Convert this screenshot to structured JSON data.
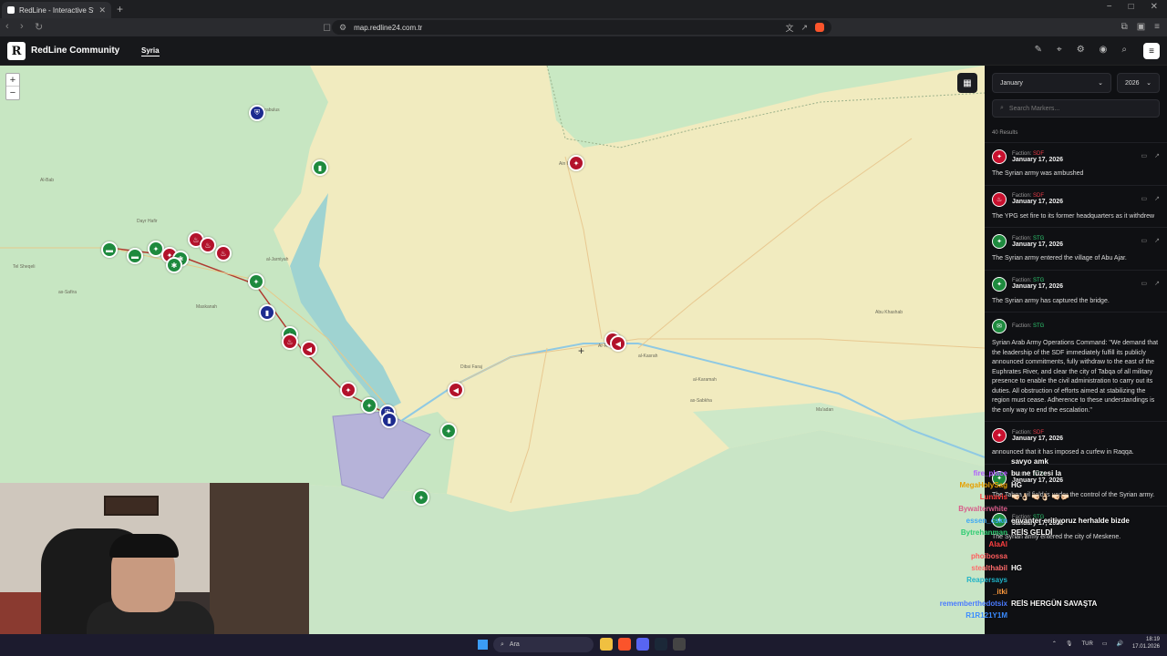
{
  "browser": {
    "tab_title": "RedLine - Interactive Strategic Map",
    "tab_close": "✕",
    "new_tab": "+",
    "url": "map.redline24.com.tr"
  },
  "header": {
    "logo_letter": "R",
    "brand": "RedLine Community",
    "nav_tab": "Syria"
  },
  "map": {
    "zoom_in": "+",
    "zoom_out": "−",
    "labels": [
      {
        "text": "Jarabulus"
      },
      {
        "text": "Al-Bab"
      },
      {
        "text": "Tel Sheqeli"
      },
      {
        "text": "as-Safira"
      },
      {
        "text": "al-Jarniyah"
      },
      {
        "text": "Ar-Raqqah"
      },
      {
        "text": "as-Sabkha"
      },
      {
        "text": "Dibsi Faraj"
      },
      {
        "text": "Maskanah"
      },
      {
        "text": "Ma'adan"
      },
      {
        "text": "Ain Issa"
      },
      {
        "text": "al-Karamah"
      },
      {
        "text": "Abu Khashab"
      },
      {
        "text": "al-Kasrah"
      },
      {
        "text": "Dayr Hafir"
      }
    ]
  },
  "sidebar": {
    "month": "January",
    "year": "2026",
    "search_placeholder": "Search Markers...",
    "results": "40 Results",
    "faction_label": "Faction:",
    "events": [
      {
        "faction": "SDF",
        "date": "January 17, 2026",
        "text": "The Syrian army was ambushed",
        "color": "#c8102e",
        "icon": "✦"
      },
      {
        "faction": "SDF",
        "date": "January 17, 2026",
        "text": "The YPG set fire to its former headquarters as it withdrew",
        "color": "#c8102e",
        "icon": "♨"
      },
      {
        "faction": "STG",
        "date": "January 17, 2026",
        "text": "The Syrian army entered the village of Abu Ajar.",
        "color": "#1e8a3e",
        "icon": "✦"
      },
      {
        "faction": "STG",
        "date": "January 17, 2026",
        "text": "The Syrian army has captured the bridge.",
        "color": "#1e8a3e",
        "icon": "✦"
      },
      {
        "faction": "STG",
        "date": "",
        "text": "Syrian Arab Army Operations Command: \"We demand that the leadership of the SDF immediately fulfill its publicly announced commitments, fully withdraw to the east of the Euphrates River, and clear the city of Tabqa of all military presence to enable the civil administration to carry out its duties. All obstruction of efforts aimed at stabilizing the region must cease. Adherence to these understandings is the only way to end the escalation.\"",
        "color": "#1e8a3e",
        "icon": "✉"
      },
      {
        "faction": "SDF",
        "date": "January 17, 2026",
        "text": "announced that it has imposed a curfew in Raqqa.",
        "color": "#c8102e",
        "icon": "✦"
      },
      {
        "faction": "STG",
        "date": "January 17, 2026",
        "text": "The Tabqa oil field is under the control of the Syrian army.",
        "color": "#1e8a3e",
        "icon": "✦"
      },
      {
        "faction": "STG",
        "date": "January 17, 2026",
        "text": "The Syrian army entered the city of Meskene.",
        "color": "#1e8a3e",
        "icon": "✦"
      }
    ]
  },
  "chat": [
    {
      "user": "",
      "msg": "savyo amk",
      "color": "#ff8c00"
    },
    {
      "user": "fire_place",
      "msg": "bu ne füzesi la",
      "color": "#b05cff"
    },
    {
      "user": "MegaHolySag",
      "msg": "HG",
      "color": "#e6a000"
    },
    {
      "user": "Lunavis",
      "msg": "🤜🏻👌🏻 🤜🏻👌🏻 🤜🏻🤛🏻",
      "color": "#ff3b3b"
    },
    {
      "user": "Bywalterwhite",
      "msg": "",
      "color": "#d85c8a"
    },
    {
      "user": "essen_cskn",
      "msg": "envanter eritiyoruz herhalde bizde",
      "color": "#3fa9f5"
    },
    {
      "user": "Bytrehanman",
      "msg": "REİS GELDİ",
      "color": "#2ecc71"
    },
    {
      "user": "AlaAl",
      "msg": "",
      "color": "#ff4040"
    },
    {
      "user": "phoibossa",
      "msg": "",
      "color": "#ff5c5c"
    },
    {
      "user": "stealthabil",
      "msg": "HG",
      "color": "#ff6b6b"
    },
    {
      "user": "Reapersays",
      "msg": "",
      "color": "#1fb3c8"
    },
    {
      "user": "_itki",
      "msg": "",
      "color": "#ff9a3c"
    },
    {
      "user": "rememberthedotsix",
      "msg": "REİS HERGÜN SAVAŞTA",
      "color": "#4a7bff"
    },
    {
      "user": "R1R121Y1M",
      "msg": "",
      "color": "#3a8bff"
    }
  ],
  "taskbar": {
    "search": "Ara",
    "lang": "TUR",
    "time": "18:19",
    "date": "17.01.2026"
  }
}
